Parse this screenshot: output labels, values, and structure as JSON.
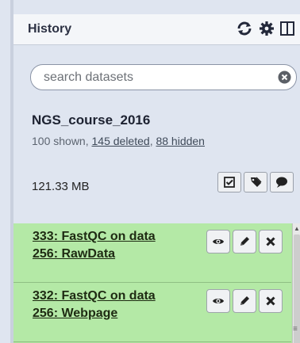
{
  "header": {
    "title": "History",
    "icons": [
      "refresh-icon",
      "gear-icon",
      "columns-icon"
    ]
  },
  "search": {
    "placeholder": "search datasets"
  },
  "history": {
    "name": "NGS_course_2016",
    "shown": "100 shown, ",
    "deleted": "145 deleted",
    "sep": ", ",
    "hidden": "88 hidden",
    "size": "121.33 MB",
    "tool_icons": [
      "checkbox-icon",
      "tag-icon",
      "comment-icon"
    ]
  },
  "datasets": [
    {
      "line1": "333: FastQC on data",
      "line2": "256: RawData",
      "state_color": "#b4e9a6"
    },
    {
      "line1": "332: FastQC on data",
      "line2": "256: Webpage",
      "state_color": "#b4e9a6"
    }
  ],
  "dataset_button_icons": [
    "eye-icon",
    "pencil-icon",
    "delete-icon"
  ]
}
